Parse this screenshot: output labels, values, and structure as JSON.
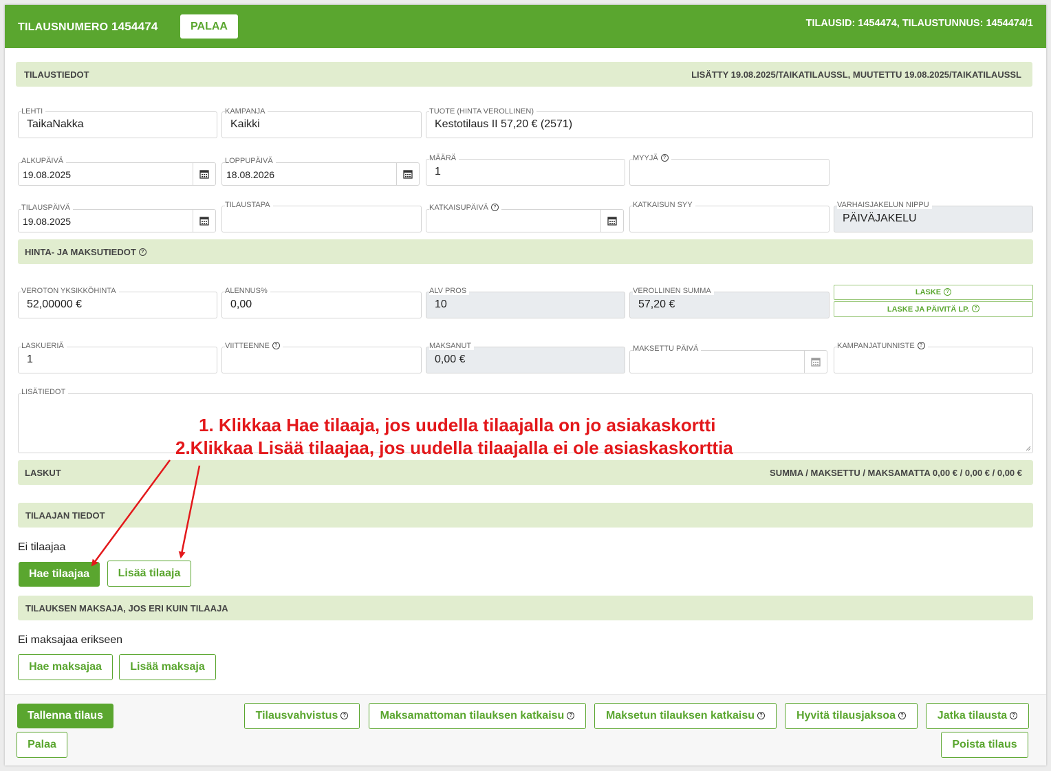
{
  "header": {
    "order_label": "TILAUSNUMERO",
    "order_number": "1454474",
    "back_button": "PALAA",
    "order_ids": "TILAUSID: 1454474, TILAUSTUNNUS: 1454474/1"
  },
  "order_info": {
    "title": "TILAUSTIEDOT",
    "meta": "LISÄTTY 19.08.2025/TAIKATILAUSSL, MUUTETTU 19.08.2025/TAIKATILAUSSL"
  },
  "fields": {
    "lehti": {
      "label": "LEHTI",
      "value": "TaikaNakka"
    },
    "kampanja": {
      "label": "KAMPANJA",
      "value": "Kaikki"
    },
    "tuote": {
      "label": "TUOTE (HINTA VEROLLINEN)",
      "value": "Kestotilaus II 57,20 € (2571)"
    },
    "alkupaiva": {
      "label": "ALKUPÄIVÄ",
      "value": "19.08.2025"
    },
    "loppupaiva": {
      "label": "LOPPUPÄIVÄ",
      "value": "18.08.2026"
    },
    "maara": {
      "label": "MÄÄRÄ",
      "value": "1"
    },
    "myyja": {
      "label": "MYYJÄ",
      "value": ""
    },
    "tilauspaiva": {
      "label": "TILAUSPÄIVÄ",
      "value": "19.08.2025"
    },
    "tilaustapa": {
      "label": "TILAUSTAPA",
      "value": ""
    },
    "katkaisupaiva": {
      "label": "KATKAISUPÄIVÄ",
      "value": ""
    },
    "katkaisun_syy": {
      "label": "KATKAISUN SYY",
      "value": ""
    },
    "varhaisjakelun_nippu": {
      "label": "VARHAISJAKELUN NIPPU",
      "value": "PÄIVÄJAKELU"
    }
  },
  "price_section": {
    "title": "HINTA- JA MAKSUTIEDOT",
    "veroton": {
      "label": "VEROTON YKSIKKÖHINTA",
      "value": "52,00000 €"
    },
    "alennus": {
      "label": "ALENNUS%",
      "value": "0,00"
    },
    "alv": {
      "label": "ALV PROS",
      "value": "10"
    },
    "verollinen": {
      "label": "VEROLLINEN SUMMA",
      "value": "57,20 €"
    },
    "laske_button": "LASKE",
    "laske_paivita_button": "LASKE JA PÄIVITÄ LP.",
    "laskueria": {
      "label": "LASKUERIÄ",
      "value": "1"
    },
    "viitteenne": {
      "label": "VIITTEENNE",
      "value": ""
    },
    "maksanut": {
      "label": "MAKSANUT",
      "value": "0,00 €"
    },
    "maksettu_paiva": {
      "label": "MAKSETTU PÄIVÄ",
      "value": ""
    },
    "kampanjatunniste": {
      "label": "KAMPANJATUNNISTE",
      "value": ""
    },
    "lisatiedot": {
      "label": "LISÄTIEDOT",
      "value": ""
    }
  },
  "invoices": {
    "title": "LASKUT",
    "summary": "SUMMA / MAKSETTU / MAKSAMATTA 0,00 € / 0,00 € / 0,00 €"
  },
  "subscriber": {
    "title": "TILAAJAN TIEDOT",
    "empty_text": "Ei tilaajaa",
    "find_button": "Hae tilaajaa",
    "add_button": "Lisää tilaaja"
  },
  "payer": {
    "title": "TILAUKSEN MAKSAJA, JOS ERI KUIN TILAAJA",
    "empty_text": "Ei maksajaa erikseen",
    "find_button": "Hae maksajaa",
    "add_button": "Lisää maksaja"
  },
  "annotation": {
    "line1": "1. Klikkaa Hae tilaaja, jos uudella tilaajalla on jo asiakaskortti",
    "line2": "2.Klikkaa Lisää tilaajaa, jos uudella tilaajalla ei ole asiaskaskorttia",
    "color": "#e3181b"
  },
  "footer": {
    "save": "Tallenna tilaus",
    "back": "Palaa",
    "confirmation": "Tilausvahvistus",
    "unpaid_cut": "Maksamattoman tilauksen katkaisu",
    "paid_cut": "Maksetun tilauksen katkaisu",
    "credit_period": "Hyvitä tilausjaksoa",
    "continue": "Jatka tilausta",
    "delete": "Poista tilaus"
  },
  "colors": {
    "brand": "#5aa62f",
    "section_bg": "#e1edcf",
    "disabled_bg": "#e9ecef"
  }
}
